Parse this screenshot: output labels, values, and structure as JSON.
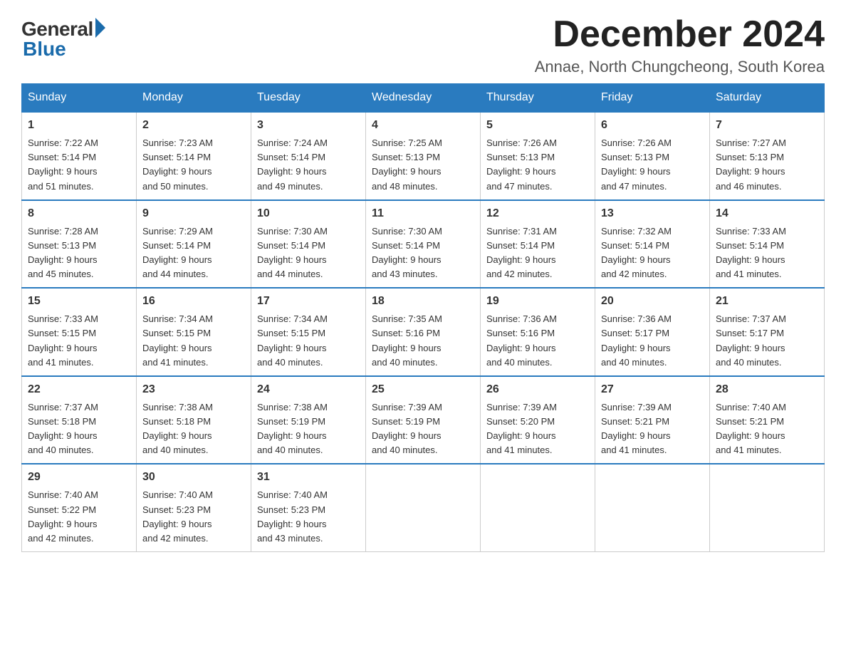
{
  "header": {
    "logo_general": "General",
    "logo_blue": "Blue",
    "month_title": "December 2024",
    "subtitle": "Annae, North Chungcheong, South Korea"
  },
  "weekdays": [
    "Sunday",
    "Monday",
    "Tuesday",
    "Wednesday",
    "Thursday",
    "Friday",
    "Saturday"
  ],
  "weeks": [
    [
      {
        "day": "1",
        "info": "Sunrise: 7:22 AM\nSunset: 5:14 PM\nDaylight: 9 hours\nand 51 minutes."
      },
      {
        "day": "2",
        "info": "Sunrise: 7:23 AM\nSunset: 5:14 PM\nDaylight: 9 hours\nand 50 minutes."
      },
      {
        "day": "3",
        "info": "Sunrise: 7:24 AM\nSunset: 5:14 PM\nDaylight: 9 hours\nand 49 minutes."
      },
      {
        "day": "4",
        "info": "Sunrise: 7:25 AM\nSunset: 5:13 PM\nDaylight: 9 hours\nand 48 minutes."
      },
      {
        "day": "5",
        "info": "Sunrise: 7:26 AM\nSunset: 5:13 PM\nDaylight: 9 hours\nand 47 minutes."
      },
      {
        "day": "6",
        "info": "Sunrise: 7:26 AM\nSunset: 5:13 PM\nDaylight: 9 hours\nand 47 minutes."
      },
      {
        "day": "7",
        "info": "Sunrise: 7:27 AM\nSunset: 5:13 PM\nDaylight: 9 hours\nand 46 minutes."
      }
    ],
    [
      {
        "day": "8",
        "info": "Sunrise: 7:28 AM\nSunset: 5:13 PM\nDaylight: 9 hours\nand 45 minutes."
      },
      {
        "day": "9",
        "info": "Sunrise: 7:29 AM\nSunset: 5:14 PM\nDaylight: 9 hours\nand 44 minutes."
      },
      {
        "day": "10",
        "info": "Sunrise: 7:30 AM\nSunset: 5:14 PM\nDaylight: 9 hours\nand 44 minutes."
      },
      {
        "day": "11",
        "info": "Sunrise: 7:30 AM\nSunset: 5:14 PM\nDaylight: 9 hours\nand 43 minutes."
      },
      {
        "day": "12",
        "info": "Sunrise: 7:31 AM\nSunset: 5:14 PM\nDaylight: 9 hours\nand 42 minutes."
      },
      {
        "day": "13",
        "info": "Sunrise: 7:32 AM\nSunset: 5:14 PM\nDaylight: 9 hours\nand 42 minutes."
      },
      {
        "day": "14",
        "info": "Sunrise: 7:33 AM\nSunset: 5:14 PM\nDaylight: 9 hours\nand 41 minutes."
      }
    ],
    [
      {
        "day": "15",
        "info": "Sunrise: 7:33 AM\nSunset: 5:15 PM\nDaylight: 9 hours\nand 41 minutes."
      },
      {
        "day": "16",
        "info": "Sunrise: 7:34 AM\nSunset: 5:15 PM\nDaylight: 9 hours\nand 41 minutes."
      },
      {
        "day": "17",
        "info": "Sunrise: 7:34 AM\nSunset: 5:15 PM\nDaylight: 9 hours\nand 40 minutes."
      },
      {
        "day": "18",
        "info": "Sunrise: 7:35 AM\nSunset: 5:16 PM\nDaylight: 9 hours\nand 40 minutes."
      },
      {
        "day": "19",
        "info": "Sunrise: 7:36 AM\nSunset: 5:16 PM\nDaylight: 9 hours\nand 40 minutes."
      },
      {
        "day": "20",
        "info": "Sunrise: 7:36 AM\nSunset: 5:17 PM\nDaylight: 9 hours\nand 40 minutes."
      },
      {
        "day": "21",
        "info": "Sunrise: 7:37 AM\nSunset: 5:17 PM\nDaylight: 9 hours\nand 40 minutes."
      }
    ],
    [
      {
        "day": "22",
        "info": "Sunrise: 7:37 AM\nSunset: 5:18 PM\nDaylight: 9 hours\nand 40 minutes."
      },
      {
        "day": "23",
        "info": "Sunrise: 7:38 AM\nSunset: 5:18 PM\nDaylight: 9 hours\nand 40 minutes."
      },
      {
        "day": "24",
        "info": "Sunrise: 7:38 AM\nSunset: 5:19 PM\nDaylight: 9 hours\nand 40 minutes."
      },
      {
        "day": "25",
        "info": "Sunrise: 7:39 AM\nSunset: 5:19 PM\nDaylight: 9 hours\nand 40 minutes."
      },
      {
        "day": "26",
        "info": "Sunrise: 7:39 AM\nSunset: 5:20 PM\nDaylight: 9 hours\nand 41 minutes."
      },
      {
        "day": "27",
        "info": "Sunrise: 7:39 AM\nSunset: 5:21 PM\nDaylight: 9 hours\nand 41 minutes."
      },
      {
        "day": "28",
        "info": "Sunrise: 7:40 AM\nSunset: 5:21 PM\nDaylight: 9 hours\nand 41 minutes."
      }
    ],
    [
      {
        "day": "29",
        "info": "Sunrise: 7:40 AM\nSunset: 5:22 PM\nDaylight: 9 hours\nand 42 minutes."
      },
      {
        "day": "30",
        "info": "Sunrise: 7:40 AM\nSunset: 5:23 PM\nDaylight: 9 hours\nand 42 minutes."
      },
      {
        "day": "31",
        "info": "Sunrise: 7:40 AM\nSunset: 5:23 PM\nDaylight: 9 hours\nand 43 minutes."
      },
      {
        "day": "",
        "info": ""
      },
      {
        "day": "",
        "info": ""
      },
      {
        "day": "",
        "info": ""
      },
      {
        "day": "",
        "info": ""
      }
    ]
  ]
}
